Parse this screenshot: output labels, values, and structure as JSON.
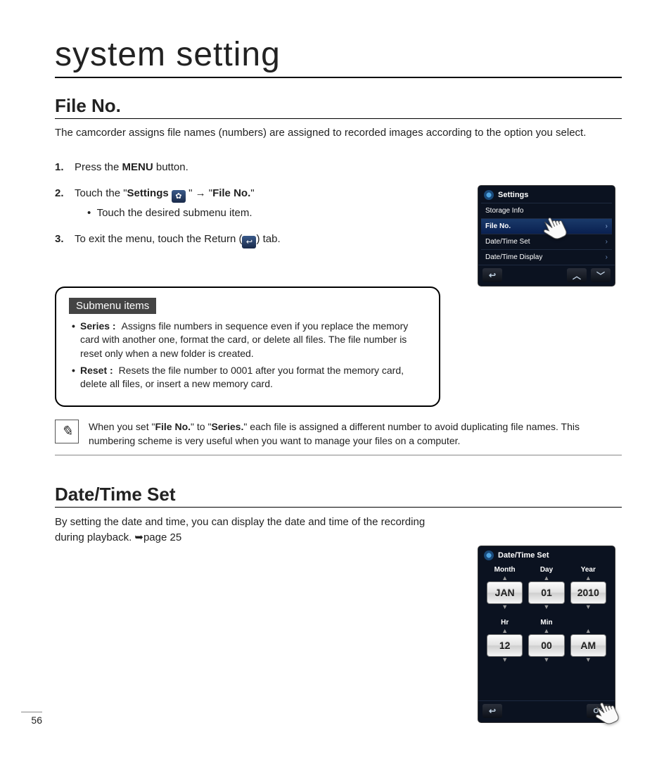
{
  "page": {
    "title": "system setting",
    "number": "56"
  },
  "file_no": {
    "heading": "File No.",
    "intro": "The camcorder assigns file names (numbers) are assigned to recorded images according to the option you select.",
    "steps": {
      "s1_a": "Press the ",
      "s1_b": "MENU",
      "s1_c": " button.",
      "s2_a": "Touch the \"",
      "s2_b": "Settings",
      "s2_c": " \" → \"",
      "s2_d": "File No.",
      "s2_e": "\"",
      "s2_bullet": "Touch the desired submenu item.",
      "s3_a": "To exit the menu, touch the Return (",
      "s3_b": ") tab."
    },
    "submenu": {
      "title": "Submenu items",
      "series_label": "Series :",
      "series_desc": "Assigns file numbers in sequence even if you replace the memory card with another one, format the card, or delete all files. The file number is reset only when a new folder is created.",
      "reset_label": "Reset :",
      "reset_desc": "Resets the file number to 0001 after you format the memory card, delete all files, or insert a new memory card."
    },
    "note_a": "When you set \"",
    "note_b": "File No.",
    "note_c": "\" to \"",
    "note_d": "Series.",
    "note_e": "\" each file is assigned a different number to avoid duplicating file names. This numbering scheme is very useful when you want to manage your files on a computer."
  },
  "date_time": {
    "heading": "Date/Time Set",
    "body": "By setting the date and time, you can display the date and time of the recording during playback. ➥page 25"
  },
  "device1": {
    "title": "Settings",
    "rows": [
      "Storage Info",
      "File No.",
      "Date/Time Set",
      "Date/Time Display"
    ]
  },
  "device2": {
    "title": "Date/Time Set",
    "labels": {
      "month": "Month",
      "day": "Day",
      "year": "Year",
      "hr": "Hr",
      "min": "Min"
    },
    "values": {
      "month": "JAN",
      "day": "01",
      "year": "2010",
      "hr": "12",
      "min": "00",
      "ampm": "AM"
    },
    "ok": "OK"
  }
}
